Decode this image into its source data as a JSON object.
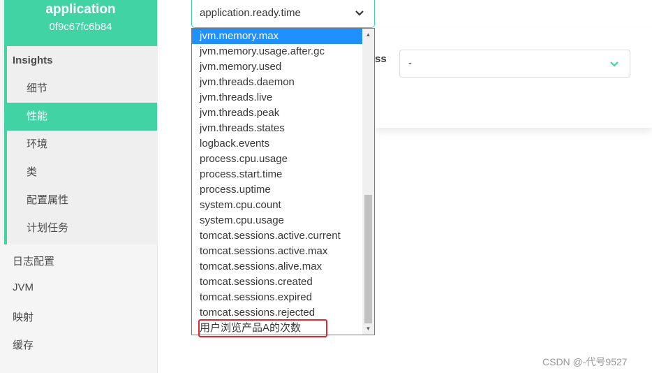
{
  "sidebar": {
    "app_name": "application",
    "app_id": "0f9c67fc6b84",
    "insights": {
      "title": "Insights",
      "items": [
        {
          "label": "细节"
        },
        {
          "label": "性能"
        },
        {
          "label": "环境"
        },
        {
          "label": "类"
        },
        {
          "label": "配置属性"
        },
        {
          "label": "计划任务"
        }
      ],
      "active_index": 1
    },
    "nav": [
      {
        "label": "日志配置"
      },
      {
        "label": "JVM"
      },
      {
        "label": "映射"
      },
      {
        "label": "缓存"
      }
    ]
  },
  "metric_select": {
    "value": "application.ready.time",
    "options": [
      "jvm.memory.max",
      "jvm.memory.usage.after.gc",
      "jvm.memory.used",
      "jvm.threads.daemon",
      "jvm.threads.live",
      "jvm.threads.peak",
      "jvm.threads.states",
      "logback.events",
      "process.cpu.usage",
      "process.start.time",
      "process.uptime",
      "system.cpu.count",
      "system.cpu.usage",
      "tomcat.sessions.active.current",
      "tomcat.sessions.active.max",
      "tomcat.sessions.alive.max",
      "tomcat.sessions.created",
      "tomcat.sessions.expired",
      "tomcat.sessions.rejected",
      "用户浏览产品A的次数"
    ],
    "highlighted_index": 0,
    "boxed_index": 19
  },
  "tag_select": {
    "label_fragment": "ss",
    "value": "-"
  },
  "colors": {
    "accent": "#42d3a5",
    "selection": "#1e90ff",
    "annotation": "#e5262a"
  },
  "watermark": "CSDN @-代号9527"
}
